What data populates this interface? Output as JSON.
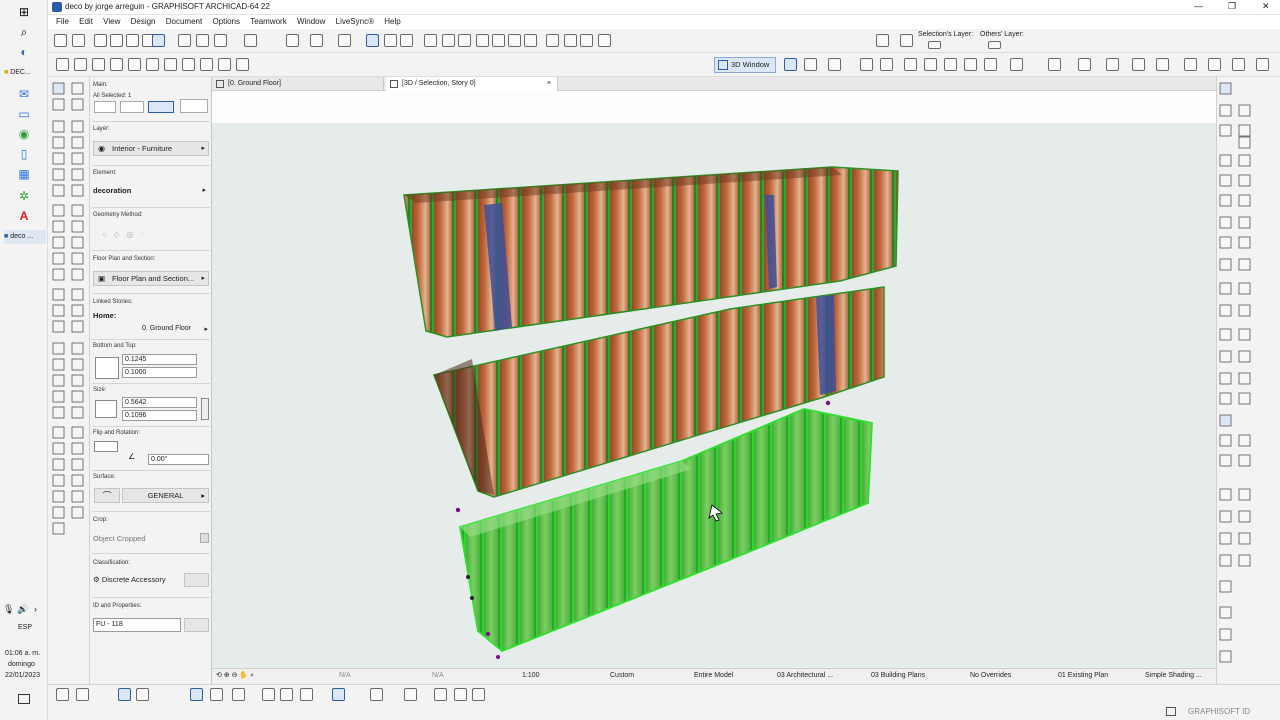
{
  "window": {
    "title": "deco by jorge arreguin - GRAPHISOFT ARCHICAD-64 22",
    "controls": [
      "—",
      "❐",
      "✕"
    ]
  },
  "menu": [
    "File",
    "Edit",
    "View",
    "Design",
    "Document",
    "Options",
    "Teamwork",
    "Window",
    "LiveSync®",
    "Help"
  ],
  "layers_toolbar": {
    "selection_layer": "Selection's Layer:",
    "others_layer": "Others' Layer:"
  },
  "view_toolbar": {
    "window_button": "3D Window"
  },
  "taskbar": {
    "apps": [
      "DEC...",
      "deco ..."
    ],
    "language": "ESP",
    "time": "01:06 a. m.",
    "day": "domingo",
    "date": "22/01/2023"
  },
  "tabs": [
    {
      "label": "[0. Ground Floor]"
    },
    {
      "label": "[3D / Selection, Story 0]",
      "close": "×"
    }
  ],
  "infobox": {
    "main_label": "Main:",
    "selected": "All Selected: 1",
    "layer_label": "Layer:",
    "layer_value": "Interior - Furniture",
    "element_label": "Element:",
    "element_value": "decoration",
    "geometry_label": "Geometry Method:",
    "floorplan_label": "Floor Plan and Section:",
    "floorplan_value": "Floor Plan and Section...",
    "linked_label": "Linked Stories:",
    "home_label": "Home:",
    "home_value": "0. Ground Floor",
    "bottom_top_label": "Bottom and Top:",
    "top_value": "0.1245",
    "bottom_value": "0.1000",
    "size_label": "Size:",
    "size_x": "0.5642",
    "size_y": "0.1096",
    "flip_label": "Flip and Rotation:",
    "rotation_value": "0.00°",
    "surface_label": "Surface:",
    "surface_value": "GENERAL",
    "crop_label": "Crop:",
    "crop_value": "Object Cropped",
    "classification_label": "Classification:",
    "classification_value": "Discrete Accessory",
    "id_label": "ID and Properties:",
    "id_value": "FU - 118"
  },
  "statusbar": {
    "na1": "N/A",
    "na2": "N/A",
    "scale": "1:100",
    "pen_set": "Custom",
    "model": "Entire Model",
    "layer_combo": "03 Architectural ...",
    "view_map": "03 Building Plans",
    "overrides": "No Overrides",
    "renovation": "01 Existing Plan",
    "shading": "Simple Shading ..."
  },
  "footer": {
    "brand": "GRAPHISOFT ID"
  },
  "colors": {
    "accent": "#2a5caa",
    "selection": "#3ee63e",
    "book_brown": "#b05a34",
    "book_blue": "#3d4f9a"
  }
}
